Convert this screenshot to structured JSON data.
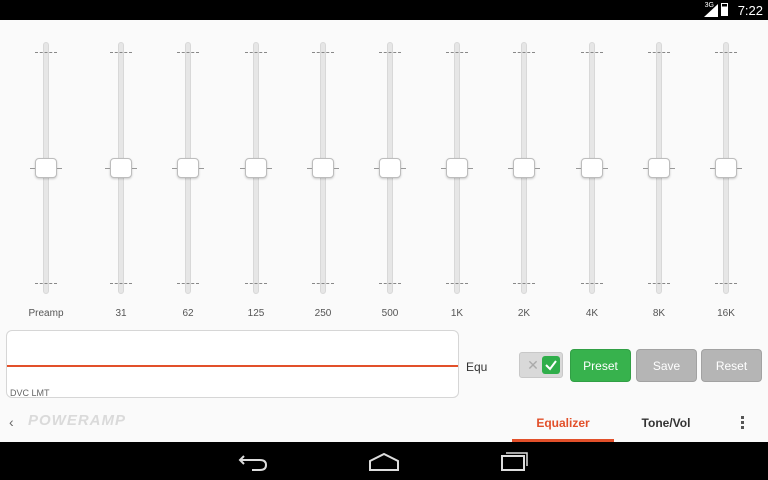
{
  "status_bar": {
    "network": "3G",
    "time": "7:22"
  },
  "equalizer": {
    "bands": [
      {
        "label": "Preamp",
        "level": 0.5
      },
      {
        "label": "31",
        "level": 0.5
      },
      {
        "label": "62",
        "level": 0.5
      },
      {
        "label": "125",
        "level": 0.5
      },
      {
        "label": "250",
        "level": 0.5
      },
      {
        "label": "500",
        "level": 0.5
      },
      {
        "label": "1K",
        "level": 0.5
      },
      {
        "label": "2K",
        "level": 0.5
      },
      {
        "label": "4K",
        "level": 0.5
      },
      {
        "label": "8K",
        "level": 0.5
      },
      {
        "label": "16K",
        "level": 0.5
      }
    ]
  },
  "curve": {
    "label": "DVC LMT",
    "line_color": "#e2502a"
  },
  "controls": {
    "equ_label": "Equ",
    "toggle_on": true,
    "preset_label": "Preset",
    "save_label": "Save",
    "reset_label": "Reset",
    "accent_green": "#37b24d"
  },
  "tabbar": {
    "logo": "POWERAMP",
    "tabs": [
      {
        "label": "Equalizer",
        "active": true
      },
      {
        "label": "Tone/Vol",
        "active": false
      }
    ],
    "accent": "#e2502a"
  },
  "icons": {
    "back": "chevron-left-icon",
    "menu": "overflow-menu-icon",
    "nav_back": "nav-back-icon",
    "nav_home": "nav-home-icon",
    "nav_recents": "nav-recents-icon"
  }
}
